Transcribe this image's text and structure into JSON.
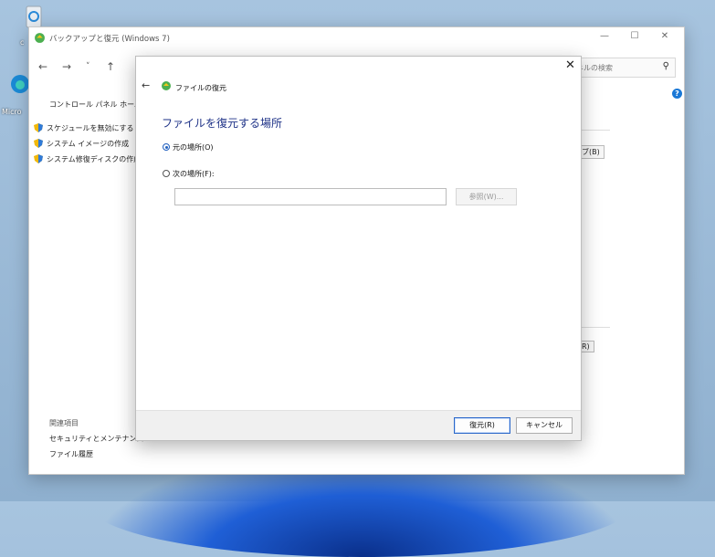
{
  "desktop": {
    "label_c": "c",
    "label_micro": "Micro"
  },
  "window": {
    "title": "バックアップと復元 (Windows 7)",
    "minimize": "—",
    "maximize": "☐",
    "close": "✕",
    "nav": {
      "back": "←",
      "forward": "→",
      "dropdown": "˅",
      "up": "↑"
    },
    "search_placeholder": "ネルの検索",
    "sidebar": {
      "home": "コントロール パネル ホーム",
      "items": [
        "スケジュールを無効にする",
        "システム イメージの作成",
        "システム修復ディスクの作成"
      ],
      "related_title": "関連項目",
      "related": [
        "セキュリティとメンテナンス",
        "ファイル履歴"
      ]
    },
    "right_fragments": [
      "ブ(B)",
      "R)"
    ],
    "help": "?"
  },
  "dialog": {
    "close": "✕",
    "back": "←",
    "title": "ファイルの復元",
    "heading": "ファイルを復元する場所",
    "options": [
      {
        "label": "元の場所(O)",
        "selected": true
      },
      {
        "label": "次の場所(F):",
        "selected": false
      }
    ],
    "path_value": "",
    "browse": "参照(W)...",
    "restore_button": "復元(R)",
    "cancel_button": "キャンセル"
  }
}
